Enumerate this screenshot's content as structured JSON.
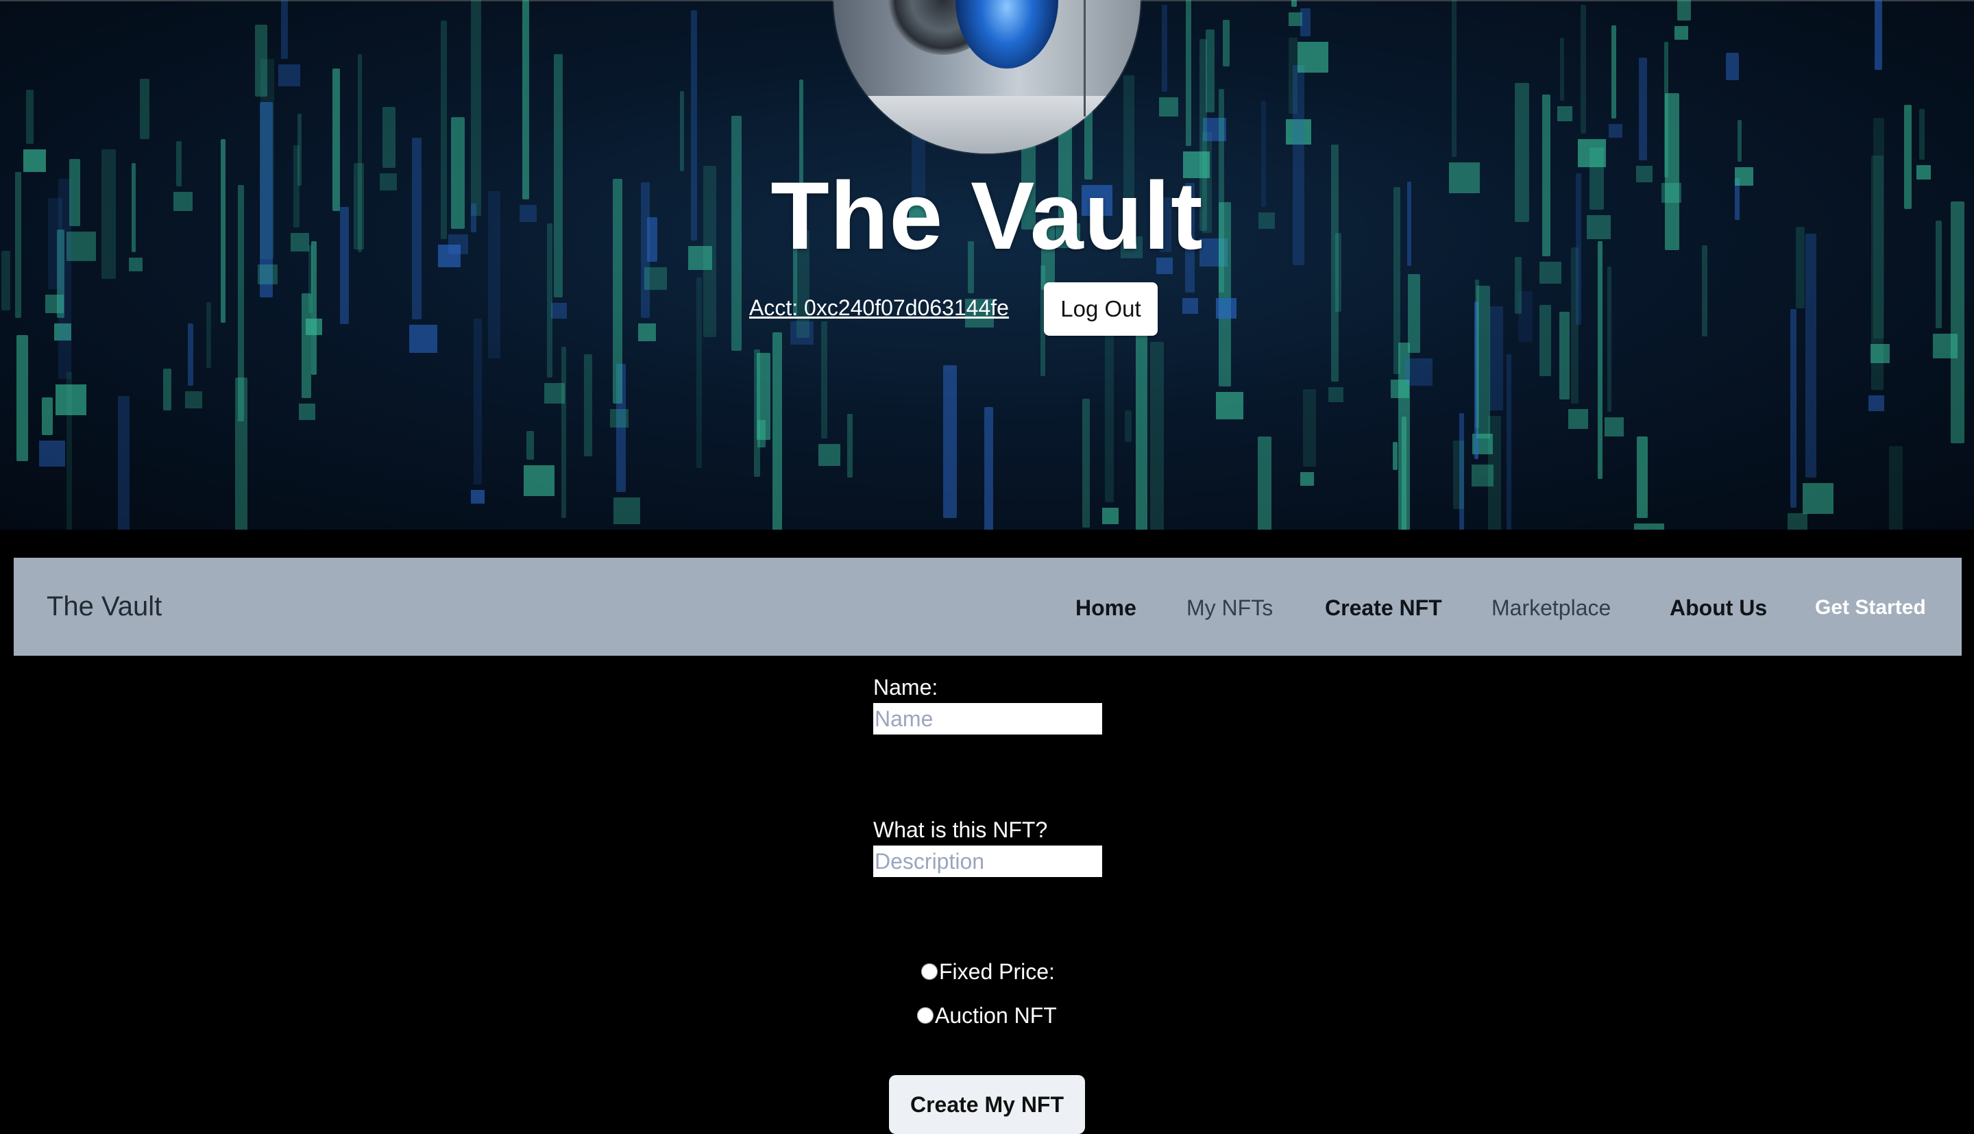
{
  "hero": {
    "title": "The Vault",
    "account": "Acct: 0xc240f07d063144fe",
    "logout_label": "Log Out"
  },
  "nav": {
    "brand": "The Vault",
    "links": [
      "Home",
      "My NFTs",
      "Create NFT",
      "Marketplace",
      "About Us"
    ],
    "cta": "Get Started"
  },
  "form": {
    "name_label": "Name:",
    "name_placeholder": "Name",
    "desc_label": "What is this NFT?",
    "desc_placeholder": "Description",
    "option_fixed": "Fixed Price:",
    "option_auction": "Auction NFT",
    "submit_label": "Create My NFT"
  },
  "colors": {
    "nav_bg": "#a3aebd",
    "page_bg": "#000000",
    "hero_bg": "#07172a",
    "rain_green": "#3fd1a6",
    "rain_blue": "#2f6fd6"
  }
}
